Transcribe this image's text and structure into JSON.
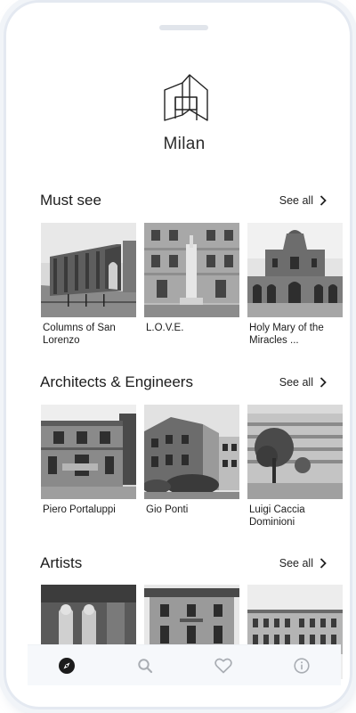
{
  "city": {
    "name": "Milan"
  },
  "sections": [
    {
      "title": "Must see",
      "see_all": "See all",
      "items": [
        {
          "caption": "Columns of San Lorenzo"
        },
        {
          "caption": "L.O.V.E."
        },
        {
          "caption": "Holy Mary of the Miracles ..."
        }
      ]
    },
    {
      "title": "Architects & Engineers",
      "see_all": "See all",
      "items": [
        {
          "caption": "Piero Portaluppi"
        },
        {
          "caption": "Gio Ponti"
        },
        {
          "caption": "Luigi Caccia Dominioni"
        }
      ]
    },
    {
      "title": "Artists",
      "see_all": "See all",
      "items": [
        {
          "caption": ""
        },
        {
          "caption": ""
        },
        {
          "caption": ""
        }
      ]
    }
  ],
  "tabbar": {
    "items": [
      {
        "icon": "compass-icon",
        "active": true
      },
      {
        "icon": "search-icon",
        "active": false
      },
      {
        "icon": "heart-icon",
        "active": false
      },
      {
        "icon": "info-icon",
        "active": false
      }
    ]
  },
  "colors": {
    "text": "#1c1c1c",
    "icon_inactive": "#a9adb3",
    "frame": "#e4e9f1"
  }
}
